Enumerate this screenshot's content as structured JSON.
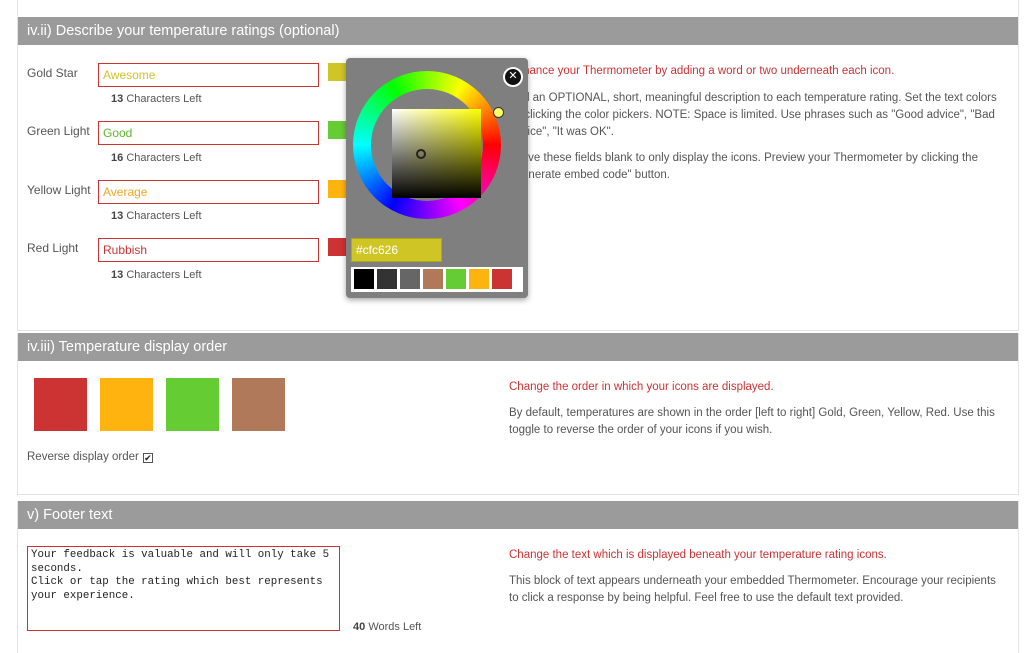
{
  "ratings_section": {
    "title": "iv.ii) Describe your temperature ratings (optional)",
    "items": [
      {
        "label": "Gold Star",
        "value": "Awesome",
        "text_color": "#d4c22a",
        "chars_count": "13",
        "chars_suffix": "Characters Left",
        "swatch": "#cfc626"
      },
      {
        "label": "Green Light",
        "value": "Good",
        "text_color": "#5cb82e",
        "chars_count": "16",
        "chars_suffix": "Characters Left",
        "swatch": "#66cc33"
      },
      {
        "label": "Yellow Light",
        "value": "Average",
        "text_color": "#f5a623",
        "chars_count": "13",
        "chars_suffix": "Characters Left",
        "swatch": "#ffb30f"
      },
      {
        "label": "Red Light",
        "value": "Rubbish",
        "text_color": "#cc3333",
        "chars_count": "13",
        "chars_suffix": "Characters Left",
        "swatch": "#cc3333"
      }
    ],
    "help_title": "Enhance your Thermometer by adding a word or two underneath each icon.",
    "help_text_1": "Add an OPTIONAL, short, meaningful description to each temperature rating. Set the text colors by clicking the color pickers. NOTE: Space is limited. Use phrases such as \"Good advice\", \"Bad advice\", \"It was OK\".",
    "help_text_2": "Leave these fields blank to only display the icons. Preview your Thermometer by clicking the \"Generate embed code\" button."
  },
  "color_picker": {
    "hex_value": "#cfc626",
    "close_symbol": "✕",
    "presets": [
      "#000000",
      "#333333",
      "#666666",
      "#b07a5a",
      "#66cc33",
      "#ffb30f",
      "#cc3333"
    ]
  },
  "order_section": {
    "title": "iv.iii) Temperature display order",
    "tiles": [
      "#cc3333",
      "#ffb30f",
      "#66cc33",
      "#b07a5a"
    ],
    "reverse_label": "Reverse display order",
    "reverse_checked": true,
    "help_title": "Change the order in which your icons are displayed.",
    "help_text": "By default, temperatures are shown in the order [left to right] Gold, Green, Yellow, Red. Use this toggle to reverse the order of your icons if you wish."
  },
  "footer_section": {
    "title": "v) Footer text",
    "textarea_value": "Your feedback is valuable and will only take 5\nseconds.\nClick or tap the rating which best represents\nyour experience.",
    "words_count": "40",
    "words_suffix": "Words Left",
    "help_title": "Change the text which is displayed beneath your temperature rating icons.",
    "help_text": "This block of text appears underneath your embedded Thermometer. Encourage your recipients to click a response by being helpful. Feel free to use the default text provided."
  }
}
